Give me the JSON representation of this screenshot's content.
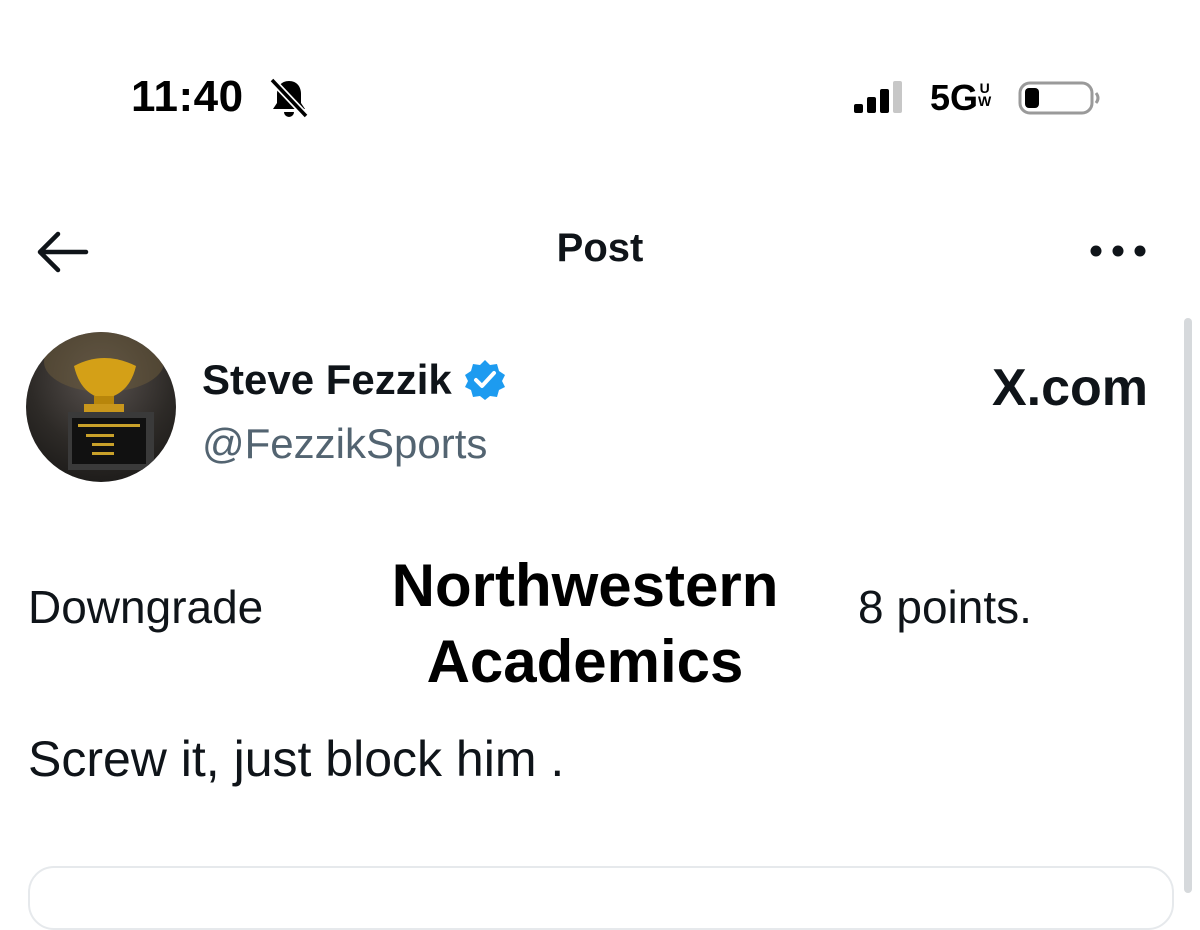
{
  "status_bar": {
    "time": "11:40",
    "network": "5G",
    "network_badge_top": "U",
    "network_badge_bottom": "W",
    "icons": [
      "bell-slash-icon",
      "signal-icon",
      "battery-icon"
    ]
  },
  "header": {
    "title": "Post",
    "icons": [
      "back-arrow-icon",
      "more-icon"
    ]
  },
  "post": {
    "author_name": "Steve Fezzik",
    "author_handle": "@FezzikSports",
    "watermark": "X.com",
    "text_before": "Downgrade",
    "overlay_line1": "Northwestern",
    "overlay_line2": "Academics",
    "text_after": "8 points.",
    "second_line": "Screw it, just block him ."
  },
  "colors": {
    "text": "#0f1419",
    "secondary": "#536471",
    "verified": "#1d9bf0"
  }
}
